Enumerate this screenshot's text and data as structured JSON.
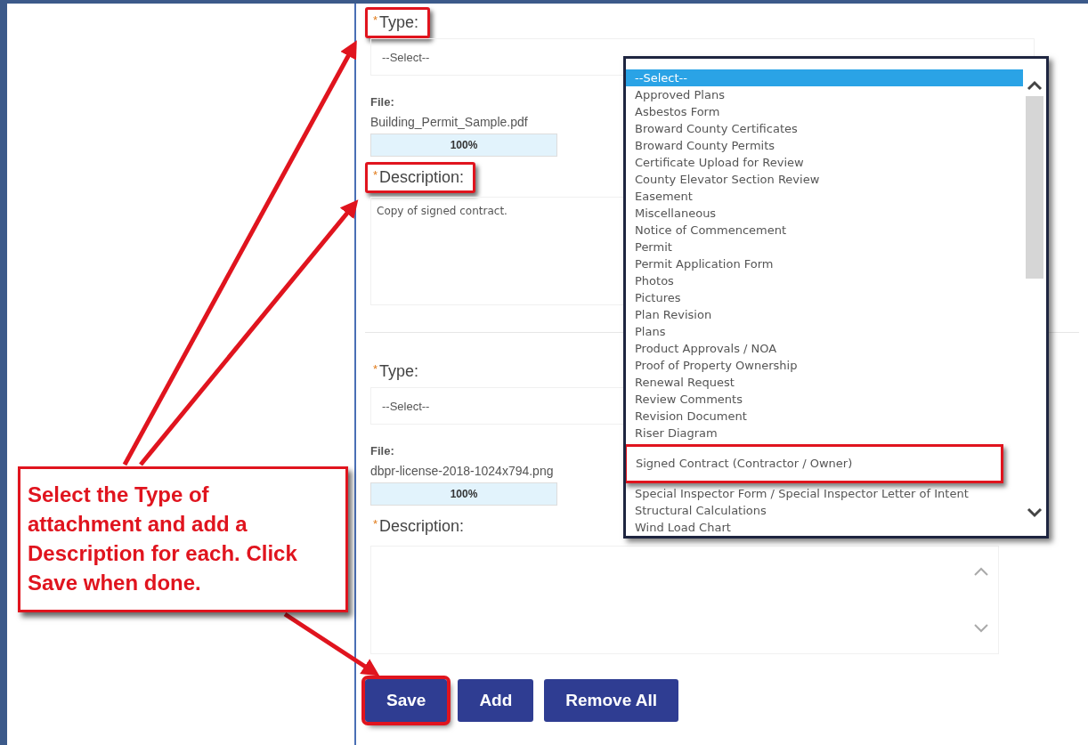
{
  "forms": [
    {
      "required_mark": "*",
      "type_label": "Type:",
      "type_highlighted": true,
      "type_value": "--Select--",
      "file_label": "File:",
      "file_name": "Building_Permit_Sample.pdf",
      "progress": {
        "level": 1,
        "reading": "100%"
      },
      "description_label": "Description:",
      "description_highlighted": true,
      "description_value": "Copy of signed contract.",
      "scroll_arrows": false
    },
    {
      "required_mark": "*",
      "type_label": "Type:",
      "type_highlighted": false,
      "type_value": "--Select--",
      "file_label": "File:",
      "file_name": "dbpr-license-2018-1024x794.png",
      "progress": {
        "level": 1,
        "reading": "100%"
      },
      "description_label": "Description:",
      "description_highlighted": false,
      "scroll_arrows": true
    }
  ],
  "type_dropdown": {
    "options": [
      {
        "label": "--Select--",
        "selected": true,
        "highlighted": false
      },
      {
        "label": "Approved Plans",
        "selected": false,
        "highlighted": false
      },
      {
        "label": "Asbestos Form",
        "selected": false,
        "highlighted": false
      },
      {
        "label": "Broward County Certificates",
        "selected": false,
        "highlighted": false
      },
      {
        "label": "Broward County Permits",
        "selected": false,
        "highlighted": false
      },
      {
        "label": "Certificate Upload for Review",
        "selected": false,
        "highlighted": false
      },
      {
        "label": "County Elevator Section Review",
        "selected": false,
        "highlighted": false
      },
      {
        "label": "Easement",
        "selected": false,
        "highlighted": false
      },
      {
        "label": "Miscellaneous",
        "selected": false,
        "highlighted": false
      },
      {
        "label": "Notice of Commencement",
        "selected": false,
        "highlighted": false
      },
      {
        "label": "Permit",
        "selected": false,
        "highlighted": false
      },
      {
        "label": "Permit Application Form",
        "selected": false,
        "highlighted": false
      },
      {
        "label": "Photos",
        "selected": false,
        "highlighted": false
      },
      {
        "label": "Pictures",
        "selected": false,
        "highlighted": false
      },
      {
        "label": "Plan Revision",
        "selected": false,
        "highlighted": false
      },
      {
        "label": "Plans",
        "selected": false,
        "highlighted": false
      },
      {
        "label": "Product Approvals / NOA",
        "selected": false,
        "highlighted": false
      },
      {
        "label": "Proof of Property Ownership",
        "selected": false,
        "highlighted": false
      },
      {
        "label": "Renewal Request",
        "selected": false,
        "highlighted": false
      },
      {
        "label": "Review Comments",
        "selected": false,
        "highlighted": false
      },
      {
        "label": "Revision Document",
        "selected": false,
        "highlighted": false
      },
      {
        "label": "Riser Diagram",
        "selected": false,
        "highlighted": false
      },
      {
        "label": "Signed Contract (Contractor / Owner)",
        "selected": false,
        "highlighted": true
      },
      {
        "label": "Special Inspector Form / Special Inspector Letter of Intent",
        "selected": false,
        "highlighted": false
      },
      {
        "label": "Structural Calculations",
        "selected": false,
        "highlighted": false
      },
      {
        "label": "Wind Load Chart",
        "selected": false,
        "highlighted": false
      }
    ]
  },
  "buttons": [
    {
      "label": "Save",
      "highlighted": true
    },
    {
      "label": "Add",
      "highlighted": false
    },
    {
      "label": "Remove All",
      "highlighted": false
    }
  ],
  "callout": {
    "text": "Select the Type of attachment and add a Description for each. Click Save when done."
  }
}
